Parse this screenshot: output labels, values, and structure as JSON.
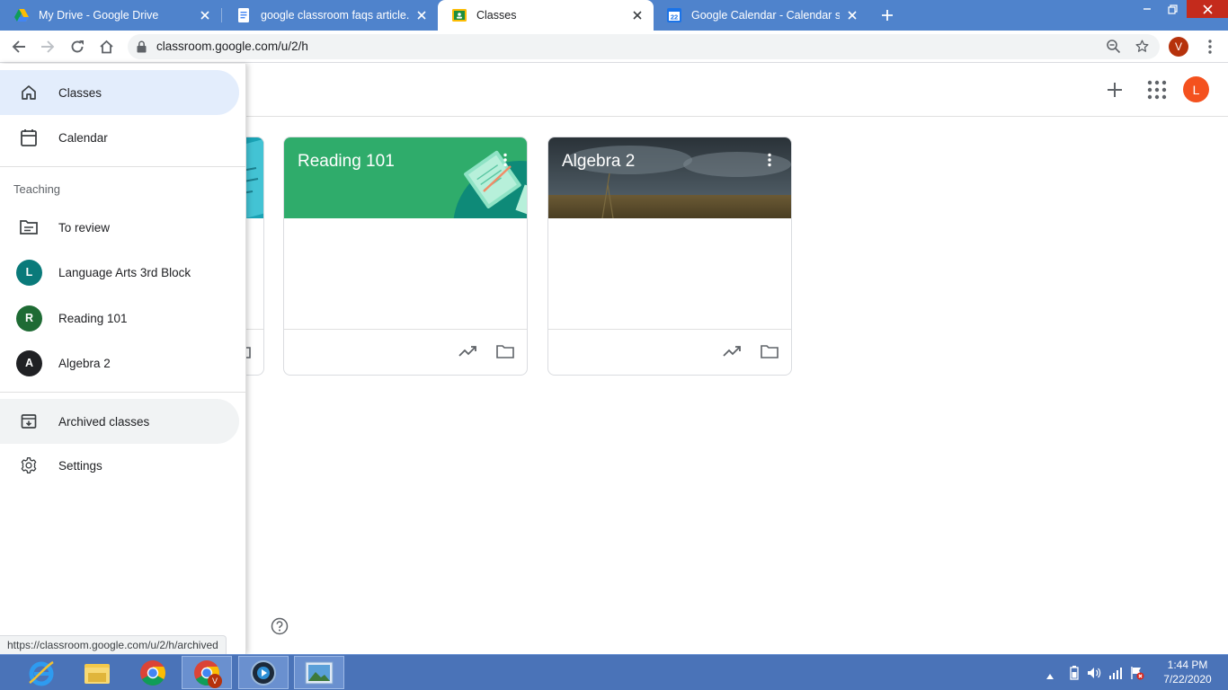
{
  "browser": {
    "tabs": [
      {
        "title": "My Drive - Google Drive",
        "icon": "drive-icon"
      },
      {
        "title": "google classroom faqs article.docx",
        "icon": "docs-icon"
      },
      {
        "title": "Classes",
        "icon": "classroom-icon",
        "active": true
      },
      {
        "title": "Google Calendar - Calendar settings",
        "icon": "calendar-icon"
      }
    ],
    "calendar_favicon_day": "22",
    "url": "classroom.google.com/u/2/h",
    "profile_initial": "V"
  },
  "appbar": {
    "avatar_initial": "L",
    "avatar_color": "#f4511e"
  },
  "drawer": {
    "classes_label": "Classes",
    "calendar_label": "Calendar",
    "teaching_heading": "Teaching",
    "to_review_label": "To review",
    "classes": [
      {
        "initial": "L",
        "name": "Language Arts 3rd Block",
        "color": "#0a7a7a"
      },
      {
        "initial": "R",
        "name": "Reading 101",
        "color": "#1e6b34"
      },
      {
        "initial": "A",
        "name": "Algebra 2",
        "color": "#202124"
      }
    ],
    "archived_label": "Archived classes",
    "settings_label": "Settings"
  },
  "cards": [
    {
      "title": "Reading 101",
      "banner_color": "#2fac6b"
    },
    {
      "title": "Algebra 2",
      "banner_color": "#3d4a52"
    }
  ],
  "status_url": "https://classroom.google.com/u/2/h/archived",
  "taskbar": {
    "time": "1:44 PM",
    "date": "7/22/2020",
    "badge_initial": "V"
  },
  "colors": {
    "accent_blue": "#1967d2",
    "selected_nav_bg": "#e3edfc",
    "chrome_frame": "#4f83cc",
    "taskbar": "#4a73b8"
  }
}
